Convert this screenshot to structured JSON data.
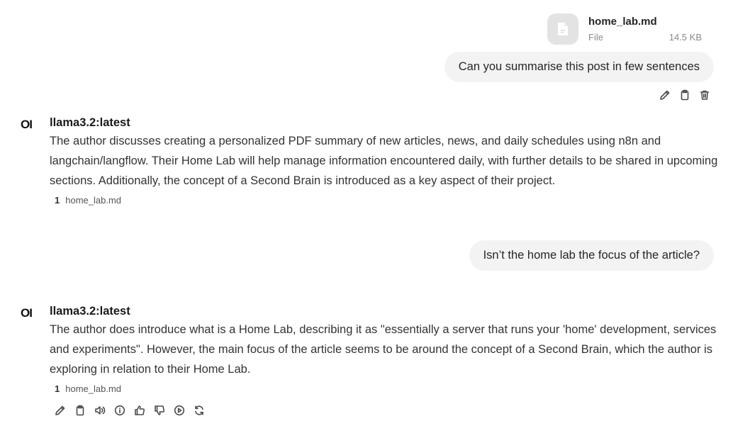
{
  "attachment": {
    "name": "home_lab.md",
    "type": "File",
    "size": "14.5 KB",
    "icon": "file-icon"
  },
  "messages": [
    {
      "role": "user",
      "text": "Can you summarise this post in few sentences"
    },
    {
      "role": "assistant",
      "logo": "OI",
      "model": "llama3.2:latest",
      "text": "The author discusses creating a personalized PDF summary of new articles, news, and daily schedules using n8n and langchain/langflow. Their Home Lab will help manage information encountered daily, with further details to be shared in upcoming sections. Additionally, the concept of a Second Brain is introduced as a key aspect of their project.",
      "citation": {
        "num": "1",
        "source": "home_lab.md"
      }
    },
    {
      "role": "user",
      "text": "Isn’t the home lab the focus of the article?"
    },
    {
      "role": "assistant",
      "logo": "OI",
      "model": "llama3.2:latest",
      "text": "The author does introduce what is a Home Lab, describing it as \"essentially a server that runs your 'home' development, services and experiments\". However, the main focus of the article seems to be around the concept of a Second Brain, which the author is exploring in relation to their Home Lab.",
      "citation": {
        "num": "1",
        "source": "home_lab.md"
      }
    }
  ],
  "user_action_icons": [
    "edit-icon",
    "copy-icon",
    "delete-icon"
  ],
  "assistant_action_icons": [
    "edit-icon",
    "copy-icon",
    "speaker-icon",
    "info-icon",
    "thumbs-up-icon",
    "thumbs-down-icon",
    "play-icon",
    "regenerate-icon"
  ],
  "colors": {
    "bubble": "#f3f3f3",
    "file_icon_bg": "#e3e3e3",
    "icon_stroke": "#4a4a4a"
  }
}
